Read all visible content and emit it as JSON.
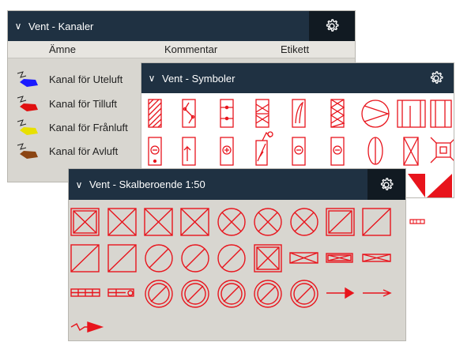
{
  "panels": {
    "kanaler": {
      "title": "Vent - Kanaler",
      "columns": [
        "Ämne",
        "Kommentar",
        "Etikett"
      ],
      "rows": [
        {
          "label": "Kanal för Uteluft",
          "color": "#1a1aff"
        },
        {
          "label": "Kanal för Tilluft",
          "color": "#e01010"
        },
        {
          "label": "Kanal för Frånluft",
          "color": "#e8e000"
        },
        {
          "label": "Kanal för Avluft",
          "color": "#8b4513"
        }
      ]
    },
    "symboler": {
      "title": "Vent - Symboler"
    },
    "skala": {
      "title": "Vent - Skalberoende 1:50"
    }
  },
  "icons": {
    "gear": "gear-icon",
    "chevron": "chevron-down-icon"
  },
  "symbol_color": "#e8141c"
}
